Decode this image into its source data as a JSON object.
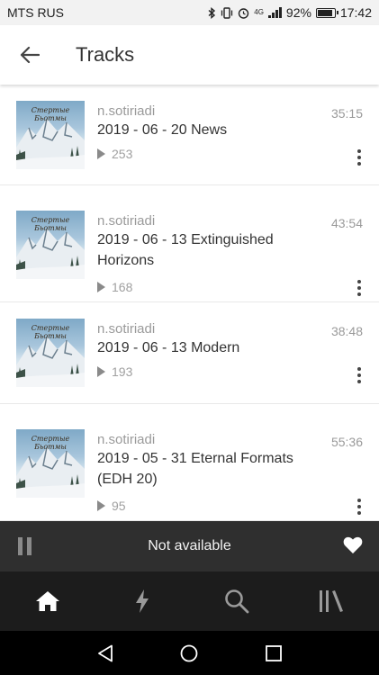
{
  "status_bar": {
    "carrier": "MTS RUS",
    "network": "4G",
    "battery_percent": "92%",
    "battery_level": 0.92,
    "time": "17:42",
    "icons": [
      "bluetooth-icon",
      "vibrate-icon",
      "alarm-icon",
      "signal-icon",
      "battery-icon"
    ]
  },
  "app_bar": {
    "title": "Tracks",
    "back_icon": "arrow-left-icon"
  },
  "tracks": [
    {
      "author": "n.sotiriadi",
      "title": "2019 - 06 - 20 News",
      "duration": "35:15",
      "plays": "253",
      "cover_text": "Стертые Бьотмы"
    },
    {
      "author": "n.sotiriadi",
      "title": "2019 - 06 - 13 Extinguished Horizons",
      "duration": "43:54",
      "plays": "168",
      "cover_text": "Стертые Бьотмы"
    },
    {
      "author": "n.sotiriadi",
      "title": "2019 - 06 - 13 Modern",
      "duration": "38:48",
      "plays": "193",
      "cover_text": "Стертые Бьотмы"
    },
    {
      "author": "n.sotiriadi",
      "title": "2019 - 05 - 31 Eternal Formats (EDH 20)",
      "duration": "55:36",
      "plays": "95",
      "cover_text": "Стертые Бьотмы"
    }
  ],
  "player": {
    "status_text": "Not available",
    "pause_icon": "pause-icon",
    "like_icon": "heart-icon"
  },
  "bottom_nav": {
    "items": [
      "home-icon",
      "lightning-icon",
      "search-icon",
      "library-icon"
    ],
    "active": "home-icon"
  },
  "android_nav": {
    "items": [
      "back-triangle-icon",
      "home-circle-icon",
      "recents-square-icon"
    ]
  },
  "colors": {
    "status_bar_bg": "#f2f2f2",
    "player_bg": "#2f2f2f",
    "bottom_nav_bg": "#1c1c1c",
    "secondary_text": "#9a9a9a"
  }
}
